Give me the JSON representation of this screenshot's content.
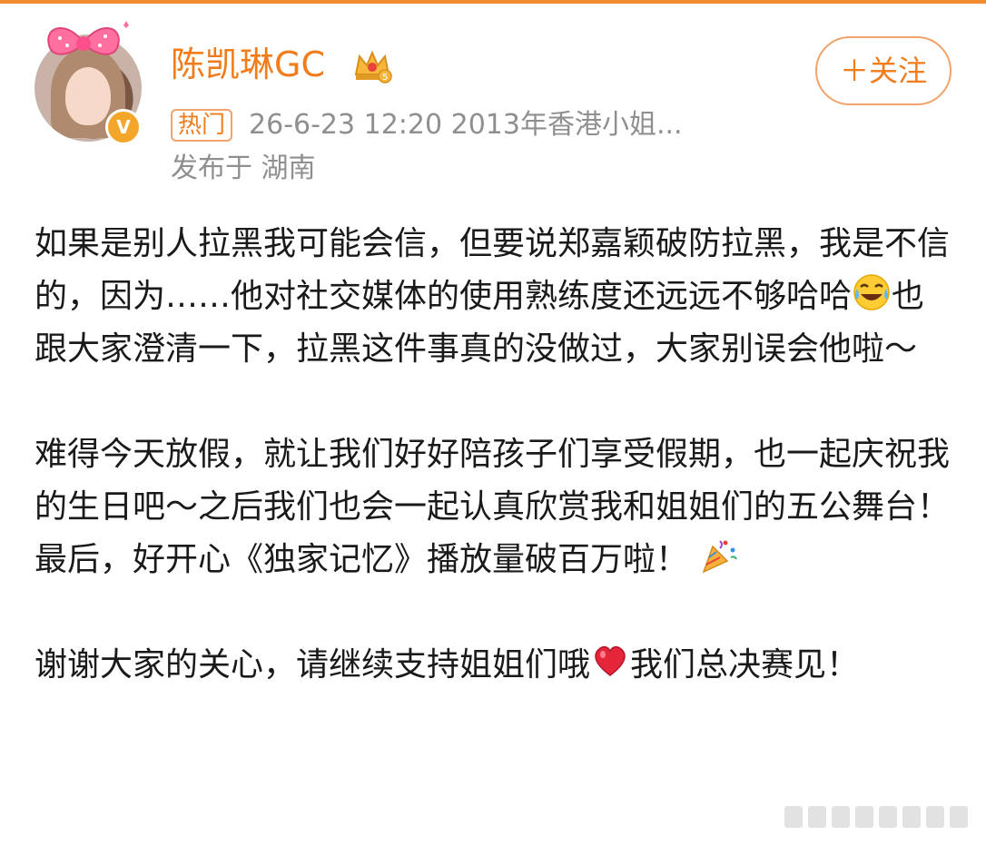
{
  "post": {
    "author": "陈凯琳GC",
    "follow_label": "＋关注",
    "badge": "热门",
    "time_and_tag": "26-6-23 12:20  2013年香港小姐...",
    "location": "发布于 湖南",
    "verified_mark": "V",
    "paragraphs": [
      {
        "before": "如果是别人拉黑我可能会信，但要说郑嘉颖破防拉黑，我是不信的，因为……他对社交媒体的使用熟练度还远远不够哈哈",
        "emoji": "laughing-tears-emoji",
        "after": "也跟大家澄清一下，拉黑这件事真的没做过，大家别误会他啦～"
      },
      {
        "before": "难得今天放假，就让我们好好陪孩子们享受假期，也一起庆祝我的生日吧～之后我们也会一起认真欣赏我和姐姐们的五公舞台！最后，好开心《独家记忆》播放量破百万啦！",
        "emoji": "party-popper-emoji",
        "after": ""
      },
      {
        "before": "谢谢大家的关心，请继续支持姐姐们哦",
        "emoji": "red-heart-emoji",
        "after": "我们总决赛见！"
      }
    ]
  },
  "colors": {
    "accent": "#f07c1b",
    "text": "#1a1a1a",
    "meta": "#8f8f8f"
  }
}
